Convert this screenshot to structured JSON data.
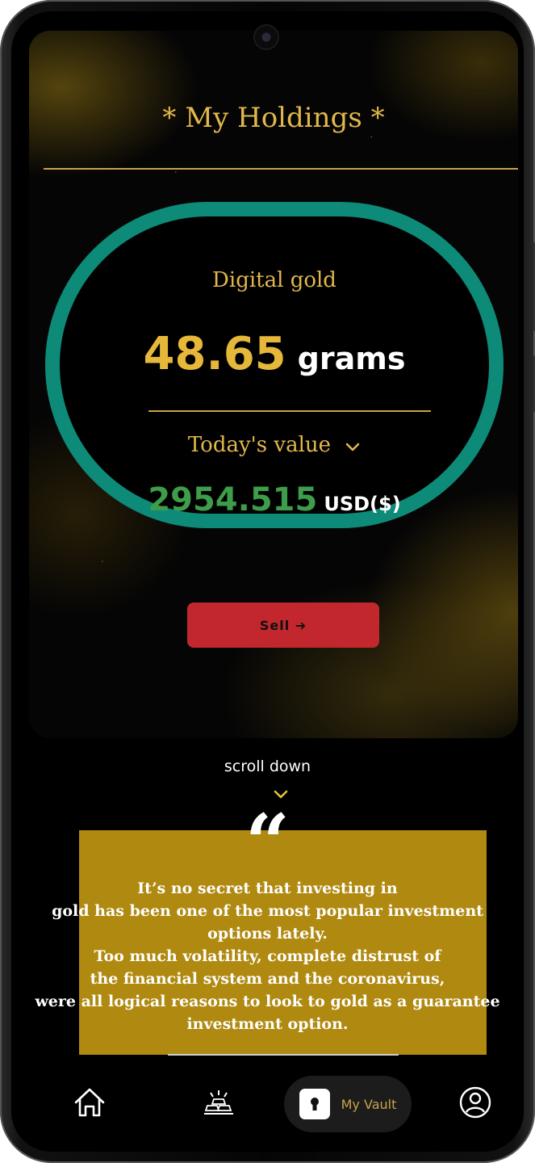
{
  "holdings": {
    "title": "* My Holdings *",
    "product_label": "Digital gold",
    "grams_value": "48.65",
    "grams_unit": "grams",
    "today_label": "Today's value",
    "usd_value": "2954.515",
    "usd_unit": "USD($)"
  },
  "actions": {
    "sell_label": "Sell ➔"
  },
  "scroll": {
    "label": "scroll down"
  },
  "quote": {
    "mark": "“",
    "lines": [
      "It’s no secret that investing in",
      "gold has been one of the most popular investment",
      "options lately.",
      "Too much volatility, complete distrust of",
      "the financial system and the coronavirus,",
      "were all logical reasons to look to gold as a guarantee",
      "investment option."
    ]
  },
  "nav": {
    "items": [
      {
        "icon": "home-icon"
      },
      {
        "icon": "gold-bars-icon"
      },
      {
        "icon": "vault-icon",
        "label": "My Vault",
        "active": true
      },
      {
        "icon": "profile-icon"
      }
    ]
  },
  "colors": {
    "accent_gold": "#e2b84a",
    "ring_teal": "#0d8a78",
    "value_green": "#3e9d4a",
    "sell_red": "#c1272d",
    "quote_bg": "#b08910"
  }
}
